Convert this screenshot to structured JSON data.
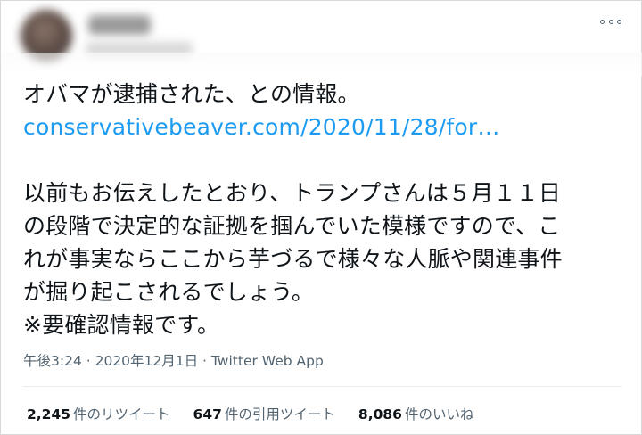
{
  "author": {
    "avatar_icon": "blurred-avatar",
    "name": "",
    "handle": ""
  },
  "tweet": {
    "lines": [
      "オバマが逮捕された、との情報。",
      "conservativebeaver.com/2020/11/28/for…",
      "",
      "以前もお伝えしたとおり、トランプさんは５月１１日",
      "の段階で決定的な証拠を掴んでいた模様ですので、こ",
      "れが事実ならここから芋づるで様々な人脈や関連事件",
      "が掘り起こされるでしょう。",
      "※要確認情報です。"
    ],
    "link_color": "#1d9bf0"
  },
  "meta": {
    "time": "午後3:24",
    "separator1": " · ",
    "date": "2020年12月1日",
    "separator2": " · ",
    "app": "Twitter Web App"
  },
  "stats": {
    "retweets_count": "2,245",
    "retweets_label": "件のリツイート",
    "quotes_count": "647",
    "quotes_label": "件の引用ツイート",
    "likes_count": "8,086",
    "likes_label": "件のいいね"
  },
  "icons": {
    "more": "more-horizontal-icon"
  }
}
